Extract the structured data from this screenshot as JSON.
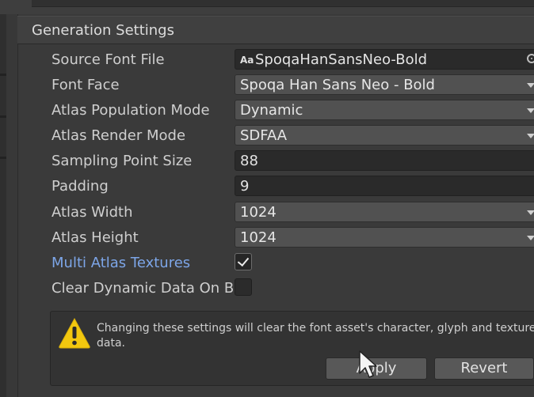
{
  "section": {
    "title": "Generation Settings"
  },
  "fields": {
    "source_font_file": {
      "label": "Source Font File",
      "icon_text": "Aa",
      "value": "SpoqaHanSansNeo-Bold"
    },
    "font_face": {
      "label": "Font Face",
      "value": "Spoqa Han Sans Neo - Bold"
    },
    "atlas_population_mode": {
      "label": "Atlas Population Mode",
      "value": "Dynamic"
    },
    "atlas_render_mode": {
      "label": "Atlas Render Mode",
      "value": "SDFAA"
    },
    "sampling_point_size": {
      "label": "Sampling Point Size",
      "value": "88"
    },
    "padding": {
      "label": "Padding",
      "value": "9"
    },
    "atlas_width": {
      "label": "Atlas Width",
      "value": "1024"
    },
    "atlas_height": {
      "label": "Atlas Height",
      "value": "1024"
    },
    "multi_atlas_textures": {
      "label": "Multi Atlas Textures",
      "checked": true
    },
    "clear_dynamic_data": {
      "label": "Clear Dynamic Data On B",
      "checked": false
    }
  },
  "warning": {
    "icon": "warning-triangle-icon",
    "text": "Changing these settings will clear the font asset's character, glyph and texture data.",
    "apply_label": "Apply",
    "revert_label": "Revert"
  },
  "colors": {
    "accent_label": "#7da6e8",
    "warning_yellow": "#f2c80f",
    "panel_bg": "#3a3a3a"
  }
}
